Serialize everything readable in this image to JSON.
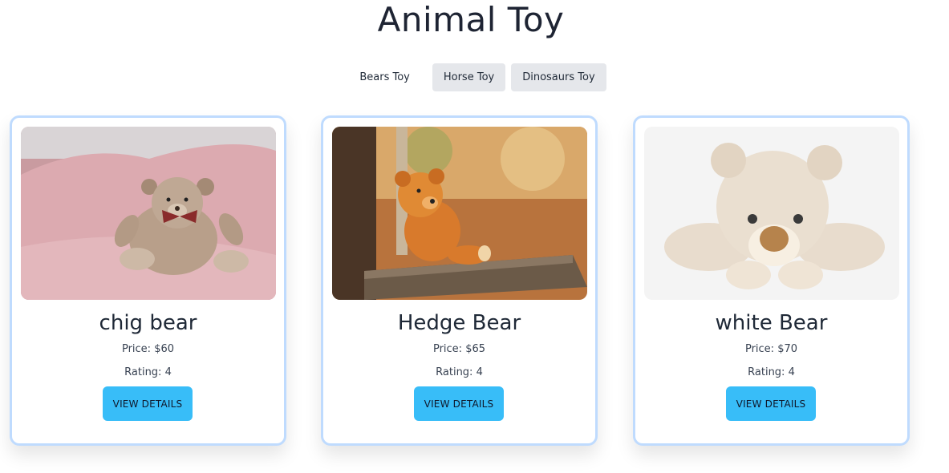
{
  "header": {
    "title": "Animal Toy"
  },
  "tabs": [
    {
      "label": "Bears Toy",
      "active": true
    },
    {
      "label": "Horse Toy",
      "active": false
    },
    {
      "label": "Dinosaurs Toy",
      "active": false
    }
  ],
  "cards": [
    {
      "name": "chig bear",
      "price": "Price: $60",
      "rating": "Rating: 4",
      "button": "VIEW DETAILS",
      "image": "teddy-bear-pink-chair"
    },
    {
      "name": "Hedge Bear",
      "price": "Price: $65",
      "rating": "Rating: 4",
      "button": "VIEW DETAILS",
      "image": "teddy-bear-on-swing"
    },
    {
      "name": "white Bear",
      "price": "Price: $70",
      "rating": "Rating: 4",
      "button": "VIEW DETAILS",
      "image": "white-teddy-bear-lying"
    }
  ],
  "colors": {
    "card_border": "#bfdbfe",
    "button": "#38bdf8",
    "tab_bg": "#e5e7eb"
  }
}
